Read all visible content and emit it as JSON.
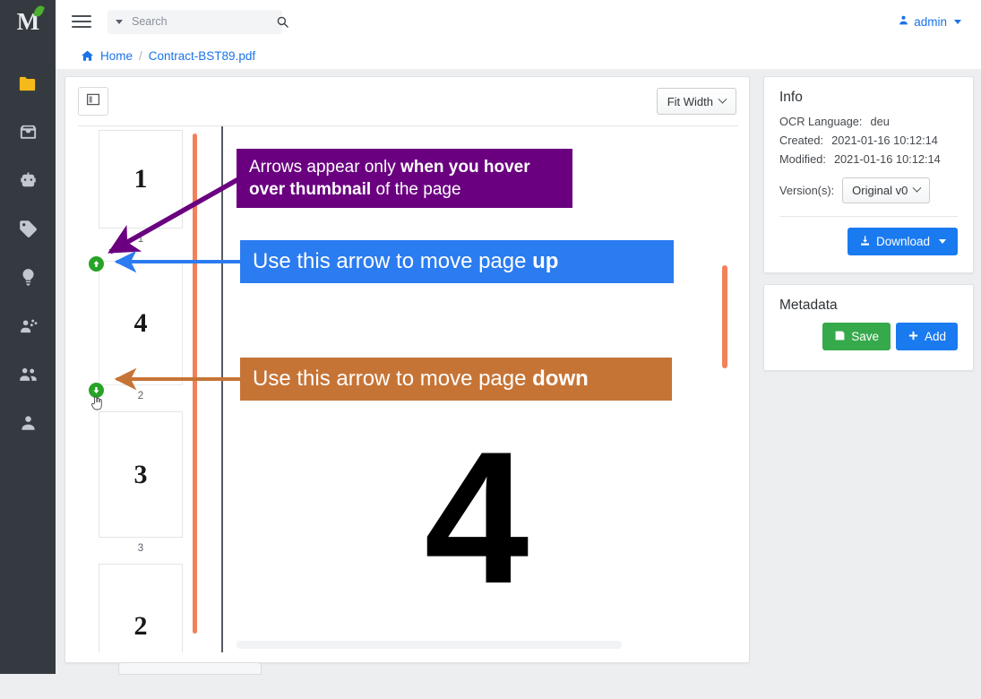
{
  "app": {
    "logo_letter": "M",
    "logo_alt": "mayan-edms-logo"
  },
  "topbar": {
    "menu_icon": "hamburger-icon",
    "search_placeholder": "Search",
    "search_value": "",
    "search_icon": "magnifier-icon",
    "user_label": "admin",
    "user_icon": "user-icon"
  },
  "breadcrumb": {
    "home_icon": "home-icon",
    "home_label": "Home",
    "separator": "/",
    "current": "Contract-BST89.pdf"
  },
  "sidebar": {
    "items": [
      {
        "name": "documents",
        "icon": "folder-icon",
        "active": true
      },
      {
        "name": "inbox",
        "icon": "inbox-icon",
        "active": false
      },
      {
        "name": "automation",
        "icon": "robot-icon",
        "active": false
      },
      {
        "name": "tags",
        "icon": "tag-icon",
        "active": false
      },
      {
        "name": "smart-links",
        "icon": "lightbulb-icon",
        "active": false
      },
      {
        "name": "user-groups",
        "icon": "users-cog-icon",
        "active": false
      },
      {
        "name": "users",
        "icon": "users-icon",
        "active": false
      },
      {
        "name": "account",
        "icon": "user-solid-icon",
        "active": false
      }
    ]
  },
  "viewer": {
    "toggle_icon": "sidebar-toggle-icon",
    "zoom_label": "Fit Width",
    "zoom_chevron": "chevron-down-icon",
    "thumbnails": [
      {
        "page_content": "1",
        "label": "1"
      },
      {
        "page_content": "4",
        "label": "2"
      },
      {
        "page_content": "3",
        "label": "3"
      },
      {
        "page_content": "2",
        "label": ""
      }
    ],
    "move_up_icon": "arrow-up-circle-icon",
    "move_down_icon": "arrow-down-circle-icon",
    "cursor_icon": "hand-pointer-icon",
    "document_page_number": "4"
  },
  "annotations": [
    {
      "id": "hover-note",
      "color": "#6a0080",
      "line1_plain": "Arrows appear only ",
      "line1_bold": "when you hover",
      "line2_bold": "over thumbnail",
      "line2_plain": " of the page",
      "arrow_color": "#6a0080"
    },
    {
      "id": "move-up-note",
      "color": "#2b7cf0",
      "text_plain": "Use this arrow to move page ",
      "text_bold": "up",
      "arrow_color": "#2b7cf0"
    },
    {
      "id": "move-down-note",
      "color": "#c67436",
      "text_plain": "Use this arrow to move page ",
      "text_bold": "down",
      "arrow_color": "#c67436"
    }
  ],
  "info_panel": {
    "title": "Info",
    "rows": [
      {
        "key": "OCR Language:",
        "value": "deu"
      },
      {
        "key": "Created:",
        "value": "2021-01-16 10:12:14"
      },
      {
        "key": "Modified:",
        "value": "2021-01-16 10:12:14"
      }
    ],
    "version_label": "Version(s):",
    "version_value": "Original v0",
    "download_label": "Download",
    "download_icon": "download-icon",
    "download_caret": "caret-down-icon"
  },
  "metadata_panel": {
    "title": "Metadata",
    "save_label": "Save",
    "save_icon": "save-icon",
    "add_label": "Add",
    "add_icon": "plus-icon"
  },
  "colors": {
    "rail_bg": "#343a40",
    "accent_blue": "#1a7af0",
    "green": "#36a94b",
    "purple": "#6a0080",
    "orange": "#c67436",
    "scrollbar": "#f0815a",
    "move_btn": "#27a327"
  }
}
